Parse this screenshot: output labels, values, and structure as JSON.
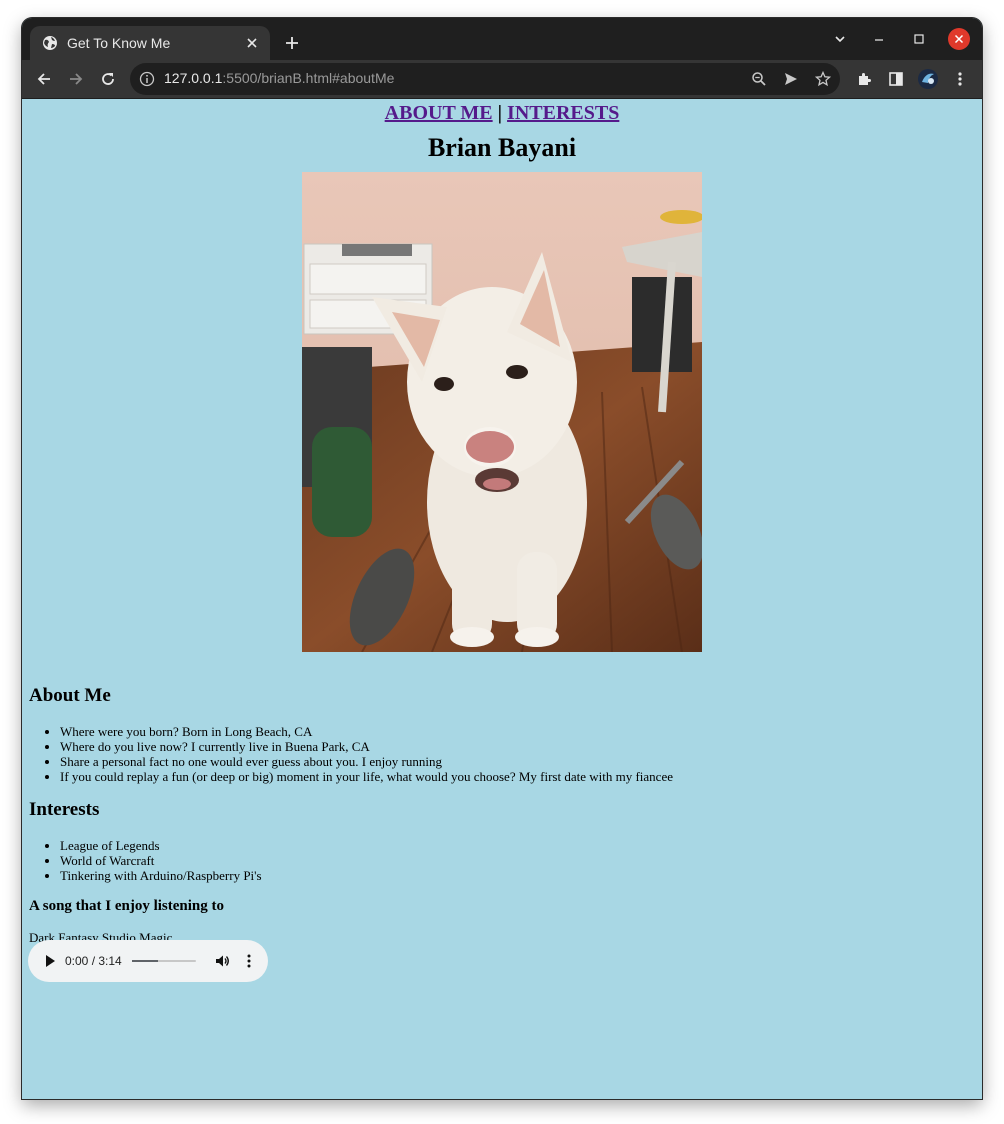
{
  "browser": {
    "tab_title": "Get To Know Me",
    "url_host": "127.0.0.1",
    "url_rest": ":5500/brianB.html#aboutMe",
    "icons": {
      "favicon": "globe-icon",
      "tab_close": "close-icon",
      "new_tab": "plus-icon",
      "tab_search": "chevron-down-icon",
      "minimize": "minimize-icon",
      "maximize": "maximize-icon",
      "close_window": "close-icon",
      "back": "arrow-left-icon",
      "forward": "arrow-right-icon",
      "reload": "reload-icon",
      "site_info": "info-icon",
      "zoom": "zoom-out-icon",
      "send": "send-icon",
      "bookmark": "star-icon",
      "extensions": "puzzle-icon",
      "side_panel": "side-panel-icon",
      "profile": "avatar",
      "menu": "kebab-menu-icon"
    }
  },
  "page": {
    "nav": {
      "about_label": "ABOUT ME",
      "separator": "|",
      "interests_label": "INTERESTS"
    },
    "name": "Brian Bayani",
    "photo_alt": "dog photo",
    "about": {
      "heading": "About Me",
      "items": [
        "Where were you born? Born in Long Beach, CA",
        "Where do you live now? I currently live in Buena Park, CA",
        "Share a personal fact no one would ever guess about you. I enjoy running",
        "If you could replay a fun (or deep or big) moment in your life, what would you choose? My first date with my fiancee"
      ]
    },
    "interests": {
      "heading": "Interests",
      "items": [
        "League of Legends",
        "World of Warcraft",
        "Tinkering with Arduino/Raspberry Pi's"
      ]
    },
    "song": {
      "heading": "A song that I enjoy listening to",
      "title": "Dark Fantasy Studio Magic"
    },
    "audio": {
      "time": "0:00 / 3:14",
      "volume_level": 1.0
    }
  },
  "colors": {
    "page_background": "#a8d7e4",
    "link": "#551a8b",
    "close_button": "#e0392b"
  }
}
